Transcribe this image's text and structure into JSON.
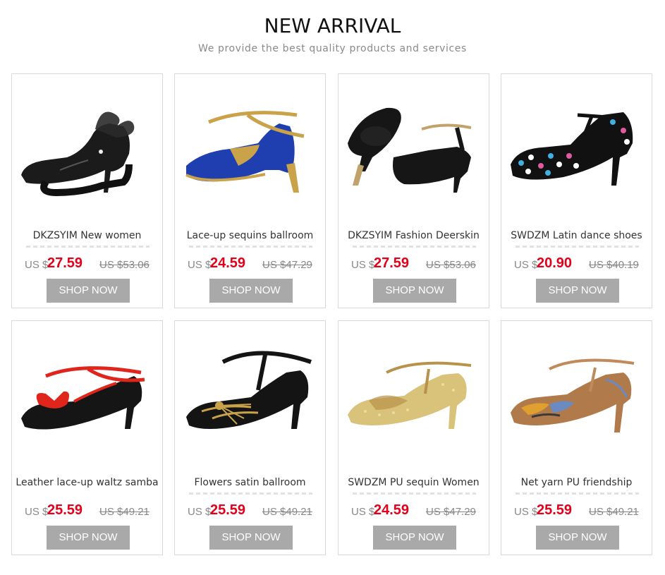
{
  "header": {
    "title": "NEW ARRIVAL",
    "subtitle": "We provide the best quality products and services"
  },
  "products": [
    {
      "name": "DKZSYIM New women",
      "currency": "US $",
      "price": "27.59",
      "old_price": "US $53.06",
      "button": "SHOP NOW",
      "image_icon": "black-mesh-bow-shoe-icon",
      "colors": {
        "primary": "#1b1b1b",
        "accent": "#2a2a2a"
      }
    },
    {
      "name": "Lace-up sequins ballroom",
      "currency": "US $",
      "price": "24.59",
      "old_price": "US $47.29",
      "button": "SHOP NOW",
      "image_icon": "blue-gold-strap-shoe-icon",
      "colors": {
        "primary": "#1f3fb0",
        "accent": "#c9a24a"
      }
    },
    {
      "name": "DKZSYIM Fashion Deerskin",
      "currency": "US $",
      "price": "27.59",
      "old_price": "US $53.06",
      "button": "SHOP NOW",
      "image_icon": "black-peeptoe-shoe-icon",
      "colors": {
        "primary": "#161616",
        "accent": "#c0a26a"
      }
    },
    {
      "name": "SWDZM Latin dance shoes",
      "currency": "US $",
      "price": "20.90",
      "old_price": "US $40.19",
      "button": "SHOP NOW",
      "image_icon": "polka-dot-tstrap-shoe-icon",
      "colors": {
        "primary": "#111111",
        "accent": "#3fb0e0"
      }
    },
    {
      "name": "Leather lace-up waltz samba",
      "currency": "US $",
      "price": "25.59",
      "old_price": "US $49.21",
      "button": "SHOP NOW",
      "image_icon": "black-red-bow-shoe-icon",
      "colors": {
        "primary": "#151515",
        "accent": "#e0261c"
      }
    },
    {
      "name": "Flowers satin ballroom",
      "currency": "US $",
      "price": "25.59",
      "old_price": "US $49.21",
      "button": "SHOP NOW",
      "image_icon": "black-satin-gold-shoe-icon",
      "colors": {
        "primary": "#141414",
        "accent": "#c9a24a"
      }
    },
    {
      "name": "SWDZM PU sequin Women",
      "currency": "US $",
      "price": "24.59",
      "old_price": "US $47.29",
      "button": "SHOP NOW",
      "image_icon": "gold-sequin-shoe-icon",
      "colors": {
        "primary": "#d9c27a",
        "accent": "#b8914a"
      }
    },
    {
      "name": "Net yarn PU friendship",
      "currency": "US $",
      "price": "25.59",
      "old_price": "US $49.21",
      "button": "SHOP NOW",
      "image_icon": "floral-mesh-shoe-icon",
      "colors": {
        "primary": "#b07a4a",
        "accent": "#6a8ac0"
      }
    }
  ]
}
